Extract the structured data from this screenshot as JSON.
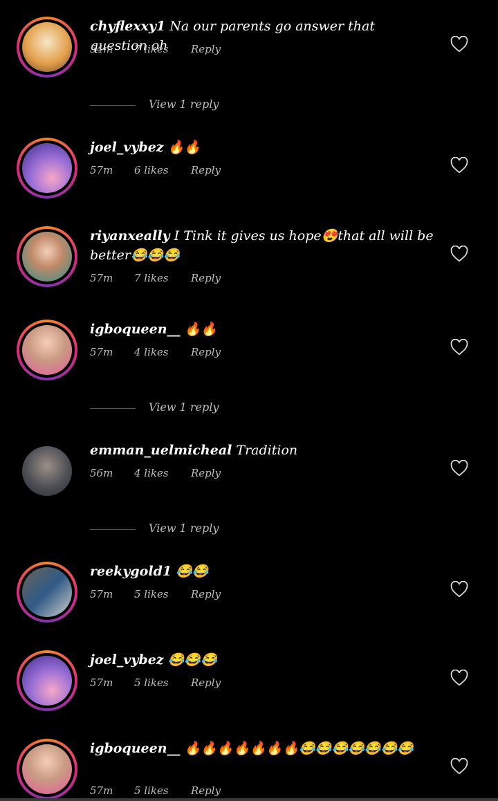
{
  "comments": [
    {
      "username": "chyflexxy1",
      "text": " Na our parents go answer that question oh",
      "time": "54m",
      "likes": "7 likes",
      "reply": "Reply",
      "avatar": "portrait-warm",
      "story_ring": true
    },
    {
      "username": "joel_vybez",
      "text": " 🔥🔥",
      "time": "57m",
      "likes": "6 likes",
      "reply": "Reply",
      "avatar": "hands-sky",
      "story_ring": true
    },
    {
      "username": "riyanxeally",
      "text": " I Tink it gives us hope😍that all will be better😂😂😂",
      "time": "57m",
      "likes": "7 likes",
      "reply": "Reply",
      "avatar": "portrait-face",
      "story_ring": true
    },
    {
      "username": "igboqueen__",
      "text": "  🔥🔥",
      "time": "57m",
      "likes": "4 likes",
      "reply": "Reply",
      "avatar": "portrait-pink",
      "story_ring": true
    },
    {
      "username": "emman_uelmicheal",
      "text": " Tradition",
      "time": "56m",
      "likes": "4 likes",
      "reply": "Reply",
      "avatar": "portrait-man",
      "story_ring": false
    },
    {
      "username": "reekygold1",
      "text": " 😂😂",
      "time": "57m",
      "likes": "5 likes",
      "reply": "Reply",
      "avatar": "street",
      "story_ring": true
    },
    {
      "username": "joel_vybez",
      "text": " 😂😂😂",
      "time": "57m",
      "likes": "5 likes",
      "reply": "Reply",
      "avatar": "hands-sky",
      "story_ring": true
    },
    {
      "username": "igboqueen__",
      "text": " 🔥🔥🔥🔥🔥🔥🔥😂😂😂😂😂😂😂",
      "time": "57m",
      "likes": "5 likes",
      "reply": "Reply",
      "avatar": "portrait-pink",
      "story_ring": true
    }
  ],
  "view_replies": [
    "View 1 reply",
    "View 1 reply",
    "View 1 reply"
  ],
  "icons": {
    "like": "heart-outline-icon"
  }
}
